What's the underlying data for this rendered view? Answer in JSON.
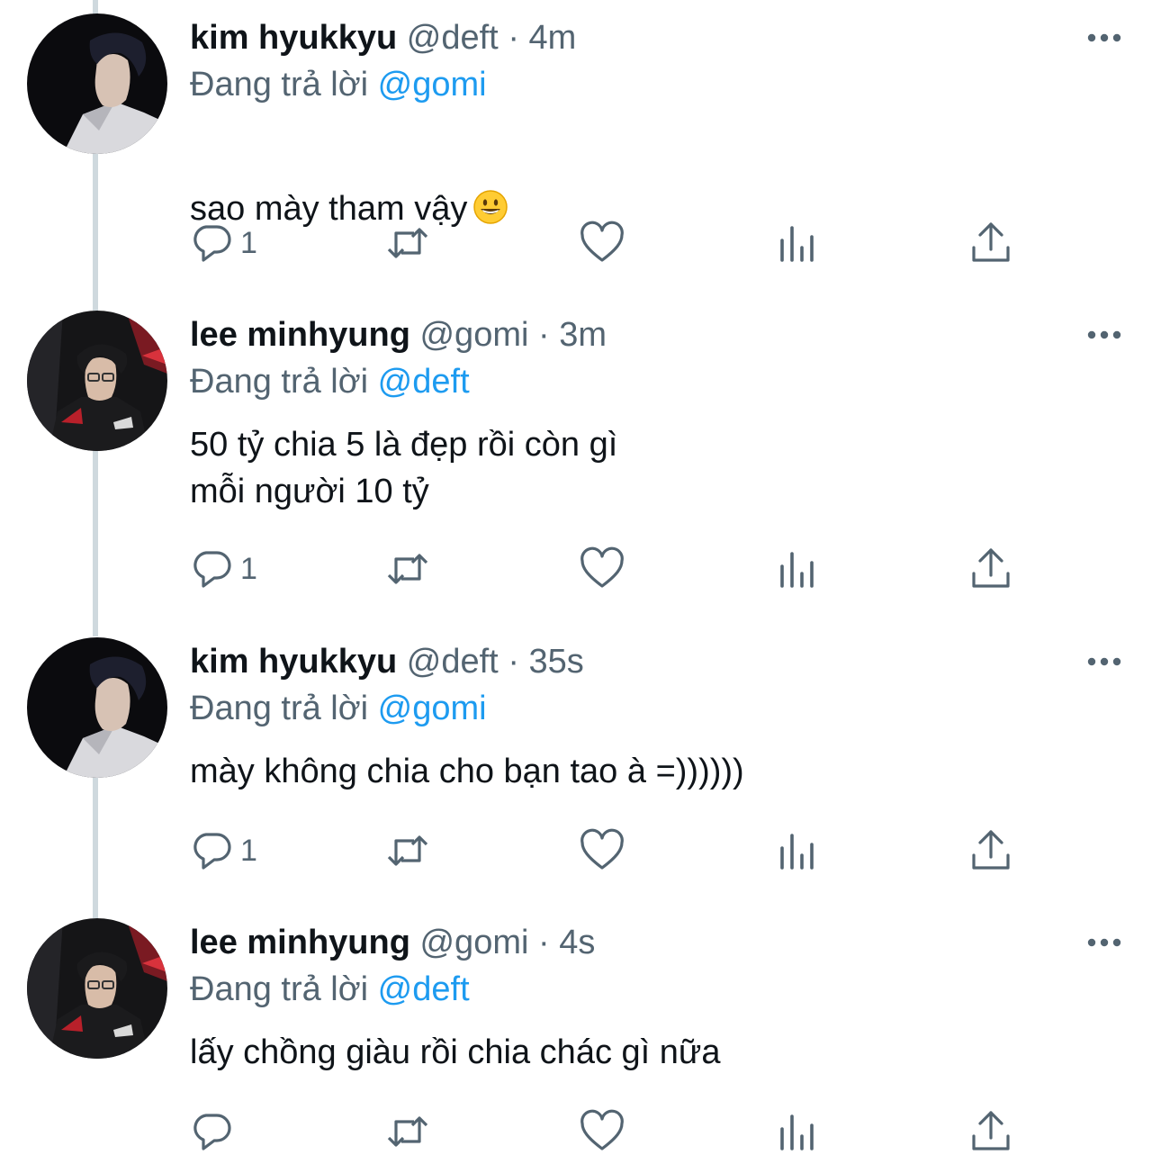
{
  "reply_prefix": "Đang trả lời",
  "separator": "·",
  "colors": {
    "text": "#0f1419",
    "secondary": "#536471",
    "link": "#1d9bf0",
    "thread_line": "#cfd9de"
  },
  "icons": {
    "reply": "reply-icon",
    "retweet": "retweet-icon",
    "like": "heart-icon",
    "views": "analytics-icon",
    "share": "share-icon",
    "more": "more-options-icon"
  },
  "tweets": [
    {
      "display_name": "kim hyukkyu",
      "handle": "@deft",
      "time": "4m",
      "reply_to": "@gomi",
      "text": "sao mày tham vậy",
      "emoji": "grinning-face",
      "reply_count": "1"
    },
    {
      "display_name": "lee minhyung",
      "handle": "@gomi",
      "time": "3m",
      "reply_to": "@deft",
      "text": "50 tỷ chia 5 là đẹp rồi còn gì\nmỗi người 10 tỷ",
      "reply_count": "1"
    },
    {
      "display_name": "kim hyukkyu",
      "handle": "@deft",
      "time": "35s",
      "reply_to": "@gomi",
      "text": "mày không chia cho bạn tao à =))))))",
      "reply_count": "1"
    },
    {
      "display_name": "lee minhyung",
      "handle": "@gomi",
      "time": "4s",
      "reply_to": "@deft",
      "text": "lấy chồng giàu rồi chia chác gì nữa",
      "reply_count": ""
    }
  ]
}
